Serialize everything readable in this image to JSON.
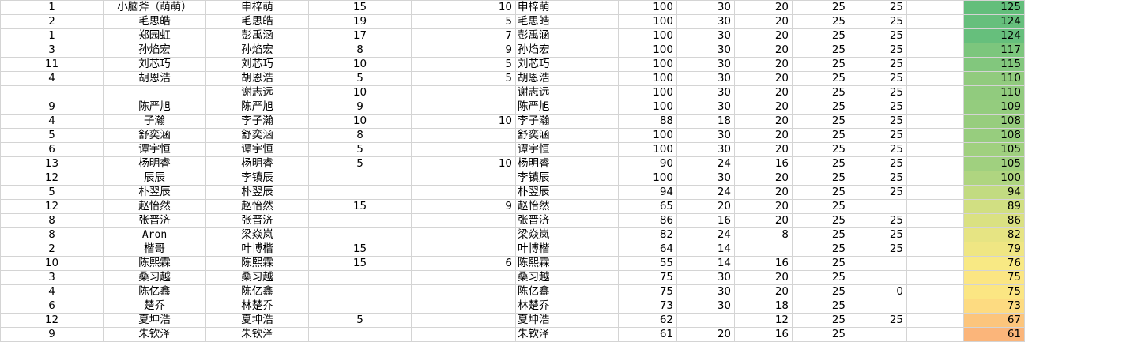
{
  "rows": [
    {
      "a": "1",
      "b": "小脑斧（萌萌）",
      "c": "申梓萌",
      "d": "15",
      "e": "10",
      "f": "申梓萌",
      "g": "100",
      "h": "30",
      "i": "20",
      "j": "25",
      "k": "25",
      "l": "",
      "m": "125",
      "color": "#63be7b"
    },
    {
      "a": "2",
      "b": "毛思皓",
      "c": "毛思皓",
      "d": "19",
      "e": "5",
      "f": "毛思皓",
      "g": "100",
      "h": "30",
      "i": "20",
      "j": "25",
      "k": "25",
      "l": "",
      "m": "124",
      "color": "#66bf7c"
    },
    {
      "a": "1",
      "b": "郑园虹",
      "c": "彭禹涵",
      "d": "17",
      "e": "7",
      "f": "彭禹涵",
      "g": "100",
      "h": "30",
      "i": "20",
      "j": "25",
      "k": "25",
      "l": "",
      "m": "124",
      "color": "#66bf7c"
    },
    {
      "a": "3",
      "b": "孙焰宏",
      "c": "孙焰宏",
      "d": "8",
      "e": "9",
      "f": "孙焰宏",
      "g": "100",
      "h": "30",
      "i": "20",
      "j": "25",
      "k": "25",
      "l": "",
      "m": "117",
      "color": "#7cc67d"
    },
    {
      "a": "11",
      "b": "刘芯巧",
      "c": "刘芯巧",
      "d": "10",
      "e": "5",
      "f": "刘芯巧",
      "g": "100",
      "h": "30",
      "i": "20",
      "j": "25",
      "k": "25",
      "l": "",
      "m": "115",
      "color": "#82c77d"
    },
    {
      "a": "4",
      "b": "胡恩浩",
      "c": "胡恩浩",
      "d": "5",
      "e": "5",
      "f": "胡恩浩",
      "g": "100",
      "h": "30",
      "i": "20",
      "j": "25",
      "k": "25",
      "l": "",
      "m": "110",
      "color": "#91cb7e"
    },
    {
      "a": "",
      "b": "",
      "c": "谢志远",
      "d": "10",
      "e": "",
      "f": "谢志远",
      "g": "100",
      "h": "30",
      "i": "20",
      "j": "25",
      "k": "25",
      "l": "",
      "m": "110",
      "color": "#91cb7e"
    },
    {
      "a": "9",
      "b": "陈严旭",
      "c": "陈严旭",
      "d": "9",
      "e": "",
      "f": "陈严旭",
      "g": "100",
      "h": "30",
      "i": "20",
      "j": "25",
      "k": "25",
      "l": "",
      "m": "109",
      "color": "#94cc7e"
    },
    {
      "a": "4",
      "b": "子瀚",
      "c": "李子瀚",
      "d": "10",
      "e": "10",
      "f": "李子瀚",
      "g": "88",
      "h": "18",
      "i": "20",
      "j": "25",
      "k": "25",
      "l": "",
      "m": "108",
      "color": "#97cd7e"
    },
    {
      "a": "5",
      "b": "舒奕涵",
      "c": "舒奕涵",
      "d": "8",
      "e": "",
      "f": "舒奕涵",
      "g": "100",
      "h": "30",
      "i": "20",
      "j": "25",
      "k": "25",
      "l": "",
      "m": "108",
      "color": "#97cd7e"
    },
    {
      "a": "6",
      "b": "谭宇恒",
      "c": "谭宇恒",
      "d": "5",
      "e": "",
      "f": "谭宇恒",
      "g": "100",
      "h": "30",
      "i": "20",
      "j": "25",
      "k": "25",
      "l": "",
      "m": "105",
      "color": "#a0d07f"
    },
    {
      "a": "13",
      "b": "杨明睿",
      "c": "杨明睿",
      "d": "5",
      "e": "10",
      "f": "杨明睿",
      "g": "90",
      "h": "24",
      "i": "16",
      "j": "25",
      "k": "25",
      "l": "",
      "m": "105",
      "color": "#a0d07f"
    },
    {
      "a": "12",
      "b": "辰辰",
      "c": "李镇辰",
      "d": "",
      "e": "",
      "f": "李镇辰",
      "g": "100",
      "h": "30",
      "i": "20",
      "j": "25",
      "k": "25",
      "l": "",
      "m": "100",
      "color": "#afd580"
    },
    {
      "a": "5",
      "b": "朴翌辰",
      "c": "朴翌辰",
      "d": "",
      "e": "",
      "f": "朴翌辰",
      "g": "94",
      "h": "24",
      "i": "20",
      "j": "25",
      "k": "25",
      "l": "",
      "m": "94",
      "color": "#c2db81"
    },
    {
      "a": "12",
      "b": "赵怡然",
      "c": "赵怡然",
      "d": "15",
      "e": "9",
      "f": "赵怡然",
      "g": "65",
      "h": "20",
      "i": "20",
      "j": "25",
      "k": "",
      "l": "",
      "m": "89",
      "color": "#d1df82"
    },
    {
      "a": "8",
      "b": "张晋济",
      "c": "张晋济",
      "d": "",
      "e": "",
      "f": "张晋济",
      "g": "86",
      "h": "16",
      "i": "20",
      "j": "25",
      "k": "25",
      "l": "",
      "m": "86",
      "color": "#dae182"
    },
    {
      "a": "8",
      "b": "Aron",
      "c": "梁焱岚",
      "d": "",
      "e": "",
      "f": "梁焱岚",
      "g": "82",
      "h": "24",
      "i": "8",
      "j": "25",
      "k": "25",
      "l": "",
      "m": "82",
      "color": "#e6e483"
    },
    {
      "a": "2",
      "b": "楷哥",
      "c": "叶博楷",
      "d": "15",
      "e": "",
      "f": "叶博楷",
      "g": "64",
      "h": "14",
      "i": "",
      "j": "25",
      "k": "25",
      "l": "",
      "m": "79",
      "color": "#efe683"
    },
    {
      "a": "10",
      "b": "陈熙霖",
      "c": "陈熙霖",
      "d": "15",
      "e": "6",
      "f": "陈熙霖",
      "g": "55",
      "h": "14",
      "i": "16",
      "j": "25",
      "k": "",
      "l": "",
      "m": "76",
      "color": "#f8e984"
    },
    {
      "a": "3",
      "b": "桑习越",
      "c": "桑习越",
      "d": "",
      "e": "",
      "f": "桑习越",
      "g": "75",
      "h": "30",
      "i": "20",
      "j": "25",
      "k": "",
      "l": "",
      "m": "75",
      "color": "#fbe683"
    },
    {
      "a": "4",
      "b": "陈亿鑫",
      "c": "陈亿鑫",
      "d": "",
      "e": "",
      "f": "陈亿鑫",
      "g": "75",
      "h": "30",
      "i": "20",
      "j": "25",
      "k": "0",
      "l": "",
      "m": "75",
      "color": "#fbe683"
    },
    {
      "a": "6",
      "b": "楚乔",
      "c": "林楚乔",
      "d": "",
      "e": "",
      "f": "林楚乔",
      "g": "73",
      "h": "30",
      "i": "18",
      "j": "25",
      "k": "",
      "l": "",
      "m": "73",
      "color": "#fddb81"
    },
    {
      "a": "12",
      "b": "夏坤浩",
      "c": "夏坤浩",
      "d": "5",
      "e": "",
      "f": "夏坤浩",
      "g": "62",
      "h": "",
      "i": "12",
      "j": "25",
      "k": "25",
      "l": "",
      "m": "67",
      "color": "#fcc57c"
    },
    {
      "a": "9",
      "b": "朱钦泽",
      "c": "朱钦泽",
      "d": "",
      "e": "",
      "f": "朱钦泽",
      "g": "61",
      "h": "20",
      "i": "16",
      "j": "25",
      "k": "",
      "l": "",
      "m": "61",
      "color": "#fbb57a"
    }
  ]
}
